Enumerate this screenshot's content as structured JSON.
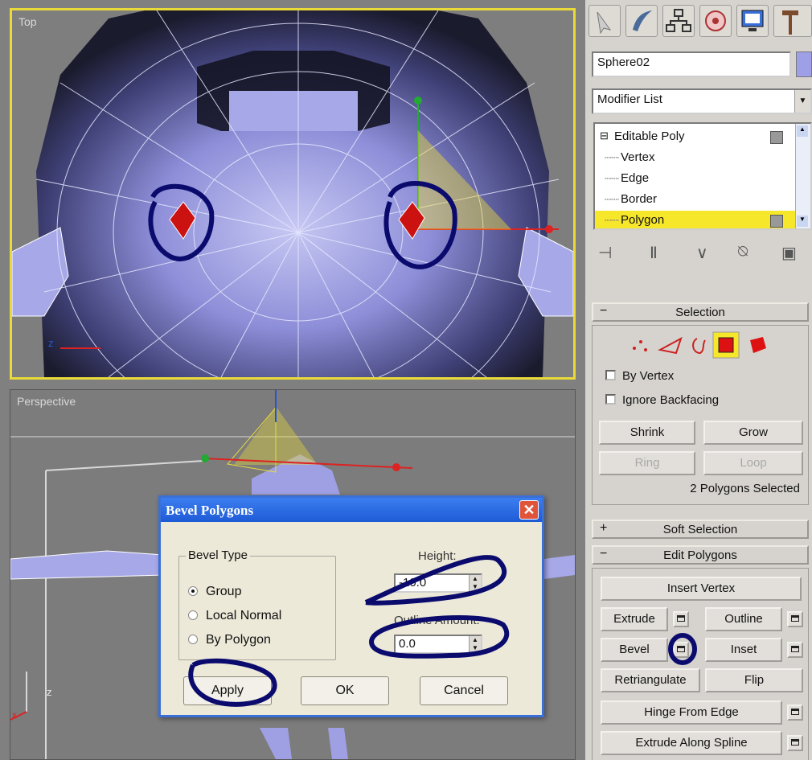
{
  "viewports": {
    "top_label": "Top",
    "perspective_label": "Perspective"
  },
  "panel": {
    "object_name": "Sphere02",
    "object_color": "#9f9fe8",
    "modifier_list": "Modifier List",
    "stack": {
      "root": "Editable Poly",
      "items": [
        "Vertex",
        "Edge",
        "Border",
        "Polygon"
      ],
      "selected": "Polygon"
    },
    "selection": {
      "title": "Selection",
      "by_vertex": "By Vertex",
      "ignore_backfacing": "Ignore Backfacing",
      "shrink": "Shrink",
      "grow": "Grow",
      "ring": "Ring",
      "loop": "Loop",
      "status": "2 Polygons Selected"
    },
    "soft_selection": {
      "title": "Soft Selection",
      "sign": "+"
    },
    "edit_polygons": {
      "title": "Edit Polygons",
      "sign": "−",
      "insert_vertex": "Insert Vertex",
      "extrude": "Extrude",
      "outline": "Outline",
      "bevel": "Bevel",
      "inset": "Inset",
      "retriangulate": "Retriangulate",
      "flip": "Flip",
      "hinge_from_edge": "Hinge From Edge",
      "extrude_along_spline": "Extrude Along Spline"
    },
    "selection_sign": "−"
  },
  "dialog": {
    "title": "Bevel Polygons",
    "close": "✕",
    "bevel_type_label": "Bevel Type",
    "options": [
      "Group",
      "Local Normal",
      "By Polygon"
    ],
    "selected_option": "Group",
    "height_label": "Height:",
    "height_value": "-10.0",
    "outline_label": "Outline Amount:",
    "outline_value": "0.0",
    "apply": "Apply",
    "ok": "OK",
    "cancel": "Cancel"
  },
  "colors": {
    "active_viewport_border": "#e9da3a",
    "stack_highlight": "#f7e72a",
    "annotation_ink": "#0b0b6e",
    "selected_polygon_red": "#cc1111"
  }
}
